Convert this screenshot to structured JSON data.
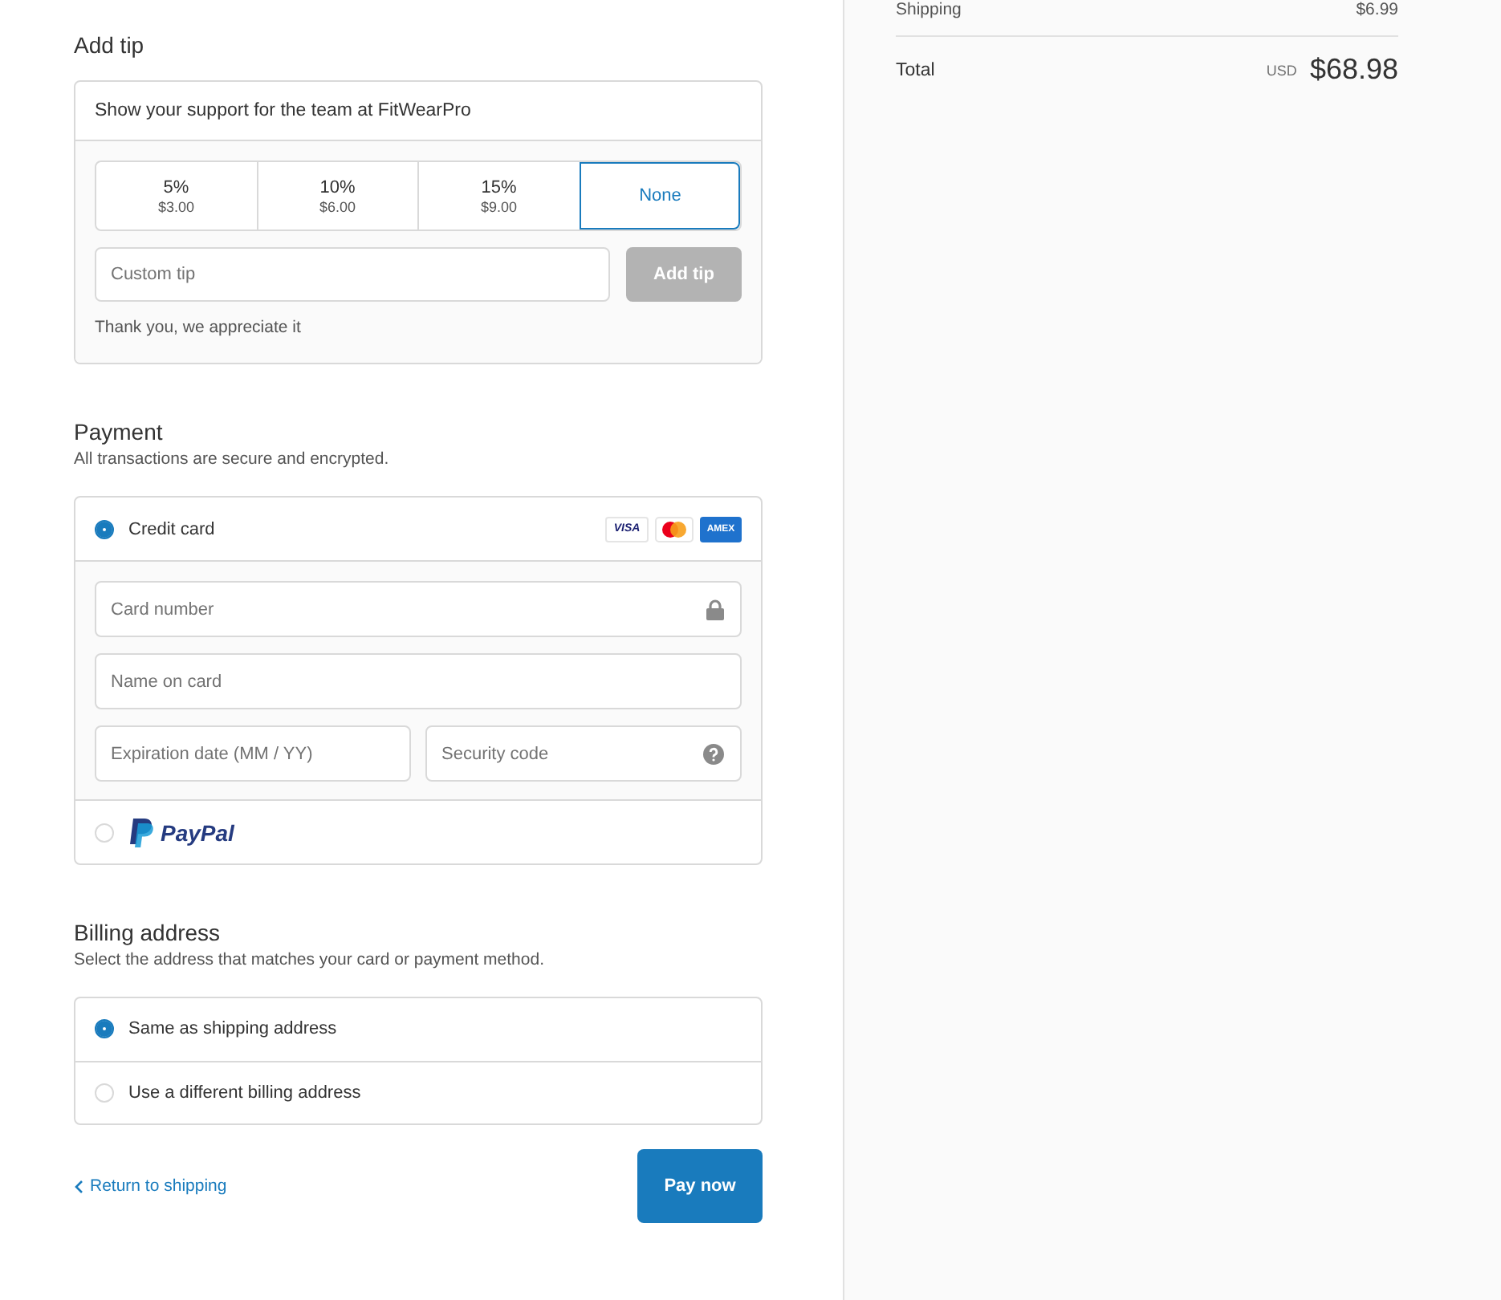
{
  "tip": {
    "title": "Add tip",
    "intro": "Show your support for the team at FitWearPro",
    "options": [
      {
        "percent": "5%",
        "amount": "$3.00",
        "selected": false
      },
      {
        "percent": "10%",
        "amount": "$6.00",
        "selected": false
      },
      {
        "percent": "15%",
        "amount": "$9.00",
        "selected": false
      },
      {
        "label": "None",
        "selected": true
      }
    ],
    "custom": {
      "placeholder": "Custom tip"
    },
    "button": {
      "label": "Add tip",
      "disabled": true
    },
    "note": "Thank you, we appreciate it"
  },
  "payment": {
    "title": "Payment",
    "subtitle": "All transactions are secure and encrypted.",
    "methods": [
      {
        "kind": "card",
        "label": "Credit card",
        "selected": true,
        "brands": [
          {
            "kind": "visa",
            "label": "VISA"
          },
          {
            "kind": "mastercard"
          },
          {
            "kind": "amex",
            "label": "AMEX"
          }
        ],
        "fields": [
          {
            "kind": "card_number",
            "placeholder": "Card number"
          },
          {
            "kind": "name",
            "placeholder": "Name on card"
          },
          {
            "kind": "expiry",
            "placeholder": "Expiration date (MM / YY)"
          },
          {
            "kind": "security_code",
            "placeholder": "Security code"
          }
        ]
      },
      {
        "kind": "paypal",
        "label": "PayPal",
        "selected": false
      }
    ]
  },
  "billing": {
    "title": "Billing address",
    "subtitle": "Select the address that matches your card or payment method.",
    "options": [
      {
        "label": "Same as shipping address",
        "selected": true
      },
      {
        "label": "Use a different billing address",
        "selected": false
      }
    ]
  },
  "footer": {
    "back_link": "Return to shipping",
    "pay_button": "Pay now"
  },
  "summary": {
    "shipping": {
      "label": "Shipping",
      "value": "$6.99"
    },
    "total": {
      "label": "Total",
      "currency": "USD",
      "value": "$68.98"
    }
  }
}
